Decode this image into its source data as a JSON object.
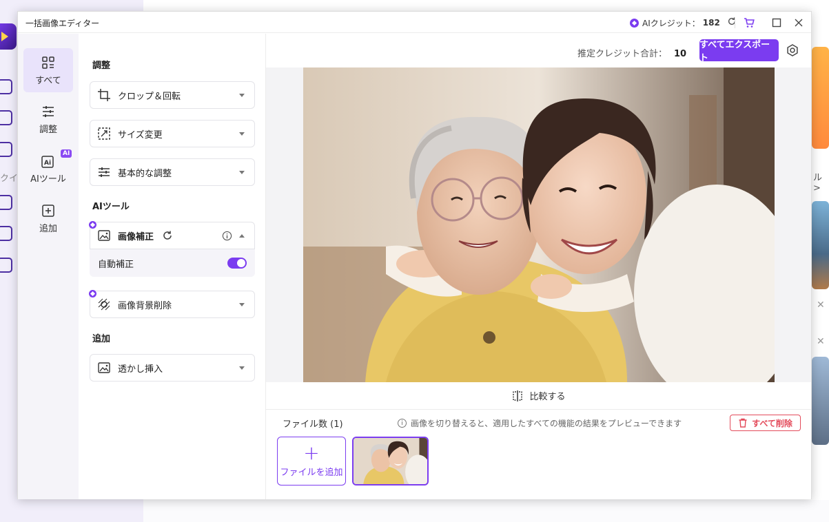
{
  "background": {
    "left_text": "クイ",
    "right_text": "ル >"
  },
  "window": {
    "title": "一括画像エディター",
    "credit_label": "AIクレジット：",
    "credit_value": "182"
  },
  "nav": {
    "items": [
      {
        "label": "すべて",
        "icon": "grid-icon",
        "active": true
      },
      {
        "label": "調整",
        "icon": "sliders-icon",
        "active": false
      },
      {
        "label": "AIツール",
        "icon": "ai-icon",
        "active": false,
        "badge": "AI"
      },
      {
        "label": "追加",
        "icon": "plus-square-icon",
        "active": false
      }
    ]
  },
  "panel": {
    "section_adjust": "調整",
    "section_ai": "AIツール",
    "section_add": "追加",
    "tools": {
      "crop": "クロップ＆回転",
      "resize": "サイズ変更",
      "basic": "基本的な調整",
      "enhance": "画像補正",
      "auto_enhance": "自動補正",
      "auto_enhance_on": true,
      "bg_remove": "画像背景削除",
      "watermark": "透かし挿入"
    }
  },
  "main": {
    "estimate_label": "推定クレジット合計：",
    "estimate_value": "10",
    "export_label": "すべてエクスポート",
    "compare_label": "比較する",
    "files_label": "ファイル数 (1)",
    "hint": "画像を切り替えると、適用したすべての機能の結果をプレビューできます",
    "delete_all": "すべて削除",
    "add_file": "ファイルを追加"
  },
  "colors": {
    "accent": "#7b3cf0",
    "danger": "#e34a5a"
  }
}
